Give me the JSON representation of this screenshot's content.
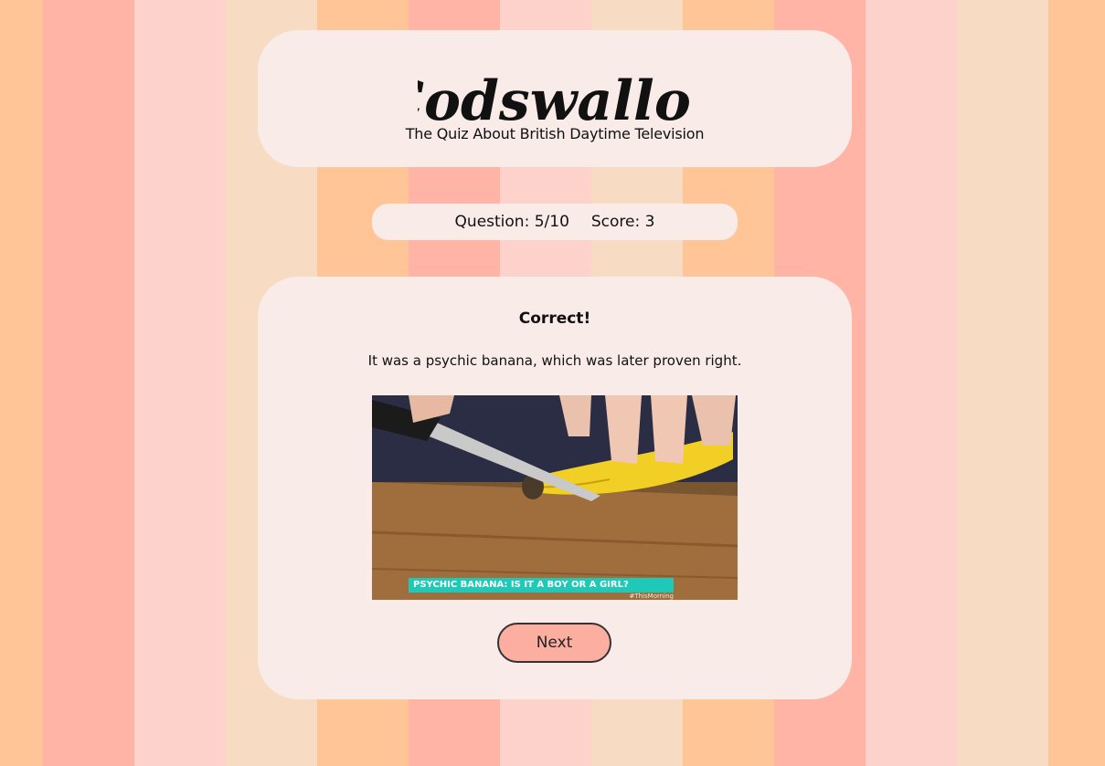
{
  "page": {
    "stripe_colors": [
      "#ffc597",
      "#ffb4a6",
      "#fdd2ca",
      "#f8dbc3",
      "#ffc597",
      "#ffb4a6",
      "#fdd2ca",
      "#f8dbc3",
      "#ffc597",
      "#ffb4a6",
      "#fdd2ca",
      "#f8dbc3",
      "#ffc597"
    ],
    "card_color": "#f8ebe8",
    "accent_color": "#fcaea0"
  },
  "header": {
    "logo_text": "Codswallop",
    "tagline": "The Quiz About British Daytime Television"
  },
  "status": {
    "question_label": "Question: 5/10",
    "score_label": "Score: 3"
  },
  "quiz": {
    "result_heading": "Correct!",
    "explanation": "It was a psychic banana, which was later proven right.",
    "image": {
      "caption": "PSYCHIC BANANA: IS IT A BOY OR A GIRL?",
      "hashtag": "#ThisMorning",
      "caption_color": "#1fc9b7"
    },
    "next_label": "Next"
  }
}
